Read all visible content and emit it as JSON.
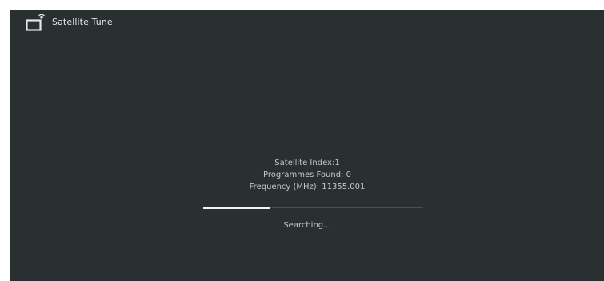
{
  "header": {
    "title": "Satellite Tune",
    "icon": "tv-satellite-icon"
  },
  "status": {
    "satellite_index": "Satellite Index:1",
    "programmes_found": "Programmes Found: 0",
    "frequency": "Frequency (MHz): 11355.001"
  },
  "progress": {
    "fraction": 0.3
  },
  "searching_label": "Searching...",
  "colors": {
    "background": "#2a3032",
    "text": "#c4c8c9",
    "progress_fill": "#f2f2f2",
    "progress_track": "#4a5153"
  }
}
